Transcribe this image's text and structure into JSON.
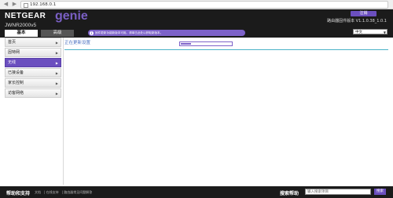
{
  "browser": {
    "url": "192.168.0.1"
  },
  "header": {
    "brand": "NETGEAR",
    "product": "genie",
    "model": "JWNR2000v5",
    "logout_label": "注销",
    "firmware": "路由器固件版本 V1.1.0.38_1.0.1",
    "notice": "固件更新功能新版本可用。请单击此处以获取新版本。",
    "language": "中文"
  },
  "tabs": [
    {
      "label": "基本"
    },
    {
      "label": "高级"
    }
  ],
  "sidebar": {
    "items": [
      {
        "label": "首页"
      },
      {
        "label": "因特网"
      },
      {
        "label": "无线"
      },
      {
        "label": "已接设备"
      },
      {
        "label": "家长控制"
      },
      {
        "label": "访客网络"
      }
    ]
  },
  "main": {
    "status_text": "正在更新设置",
    "progress": 0.2
  },
  "footer": {
    "help_title": "帮助和支持",
    "links": [
      "文档",
      "在线支持",
      "路由器常见问题解答"
    ],
    "search_label": "搜索帮助",
    "search_placeholder": "输入搜索项目",
    "search_button": "搜索"
  },
  "colors": {
    "accent": "#6b4fbf",
    "header_bg": "#1b1b1b",
    "divider": "#4ab3c8"
  }
}
